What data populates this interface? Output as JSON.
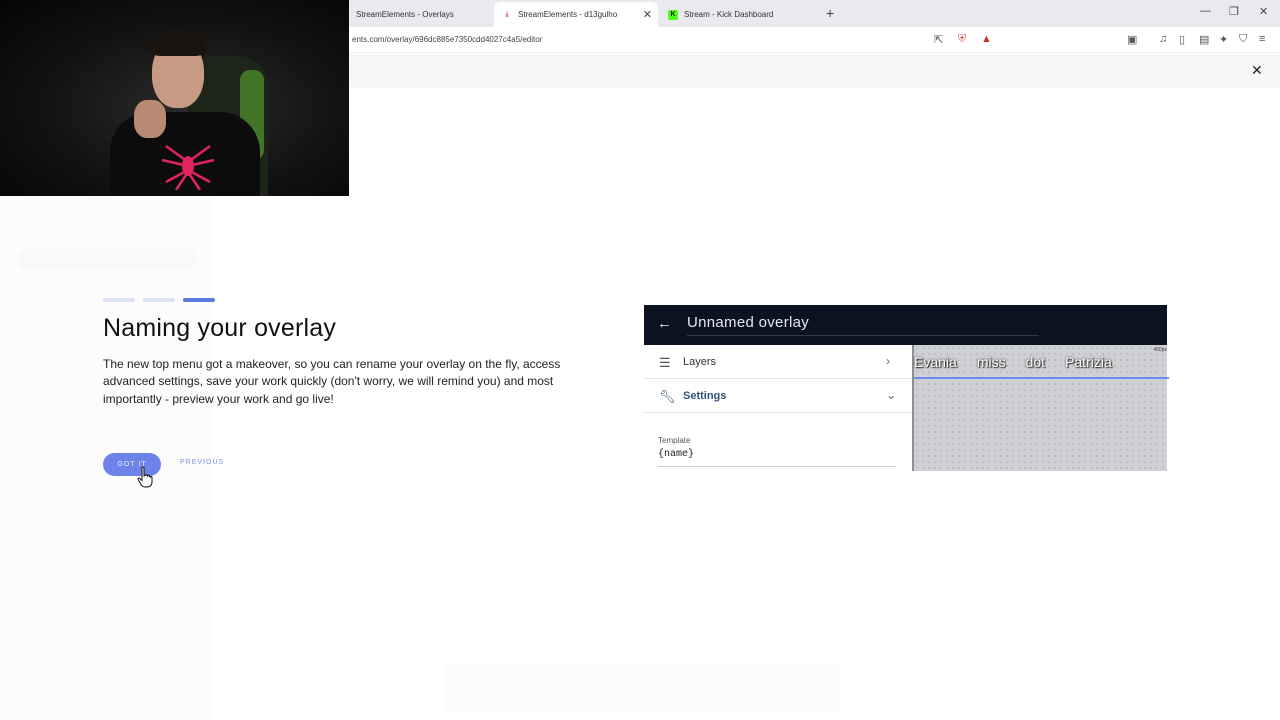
{
  "browser": {
    "tabs": [
      {
        "label": "StreamElements - Overlays",
        "active": false,
        "favicon_color": "#e8eaed"
      },
      {
        "label": "StreamElements - d13gulho",
        "active": true,
        "favicon_color": "#e0544b"
      },
      {
        "label": "Stream - Kick Dashboard",
        "active": false,
        "favicon_color": "#53fc18"
      }
    ],
    "url": "ents.com/overlay/696dc885e7350cdd4027c4a5/editor"
  },
  "onboarding": {
    "step_count": 3,
    "active_step": 3,
    "title": "Naming your overlay",
    "description": "The new top menu got a makeover, so you can rename your overlay on the fly, access advanced settings, save your work quickly (don't worry, we will remind you) and most importantly - preview your work and go live!",
    "primary_button": "GOT IT",
    "secondary_button": "PREVIOUS"
  },
  "preview": {
    "title": "Unnamed overlay",
    "rows": [
      {
        "label": "Layers",
        "icon": "layers-icon"
      },
      {
        "label": "Settings",
        "icon": "wrench-icon"
      }
    ],
    "field_label": "Template",
    "field_value": "{name}",
    "names": [
      "Evania",
      "miss",
      "dot",
      "Patrizia"
    ],
    "px_label": "400px"
  },
  "colors": {
    "accent": "#5b7be0",
    "button": "#6e83ea",
    "preview_header": "#0b1220"
  }
}
